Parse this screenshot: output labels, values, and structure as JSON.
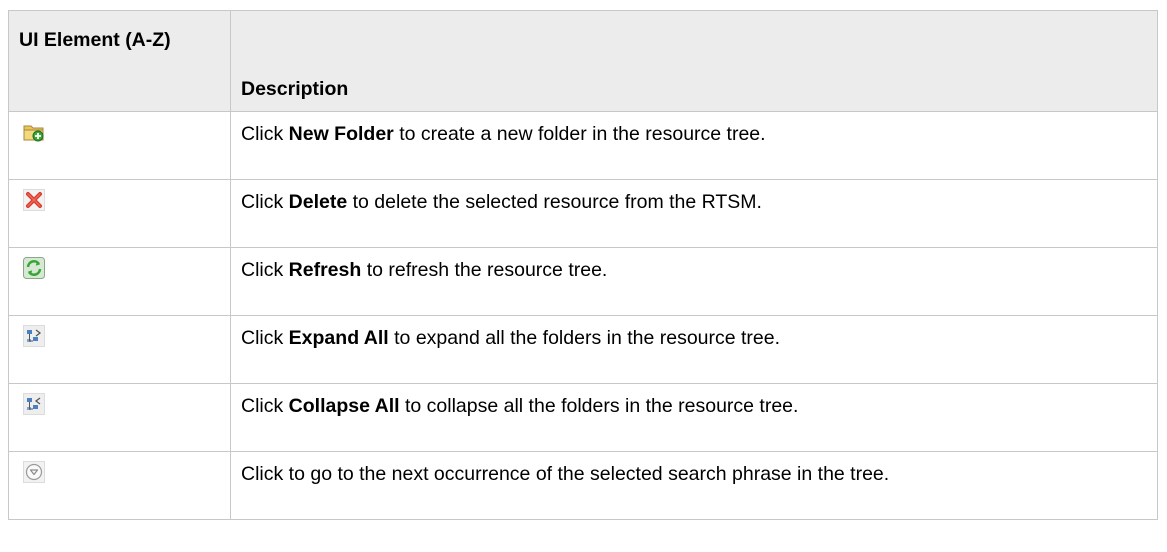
{
  "table": {
    "headers": {
      "ui_element": "UI Element (A-Z)",
      "description": "Description"
    },
    "rows": [
      {
        "icon": "new-folder-icon",
        "prefix": "Click ",
        "bold": "New Folder",
        "suffix": " to create a new folder in the resource tree."
      },
      {
        "icon": "delete-icon",
        "prefix": "Click ",
        "bold": "Delete",
        "suffix": " to delete the selected resource from the RTSM."
      },
      {
        "icon": "refresh-icon",
        "prefix": "Click ",
        "bold": "Refresh",
        "suffix": " to refresh the resource tree."
      },
      {
        "icon": "expand-all-icon",
        "prefix": "Click ",
        "bold": "Expand All",
        "suffix": " to expand all the folders in the resource tree."
      },
      {
        "icon": "collapse-all-icon",
        "prefix": "Click ",
        "bold": "Collapse All",
        "suffix": " to collapse all the folders in the resource tree."
      },
      {
        "icon": "next-occurrence-icon",
        "prefix": "Click to go to the next occurrence of the selected search phrase in the tree.",
        "bold": "",
        "suffix": ""
      }
    ]
  },
  "colors": {
    "header_bg": "#ececec",
    "border": "#c8c8c8",
    "folder": "#e8c65c",
    "delete_red": "#d6382b",
    "refresh_green": "#3aa636"
  }
}
